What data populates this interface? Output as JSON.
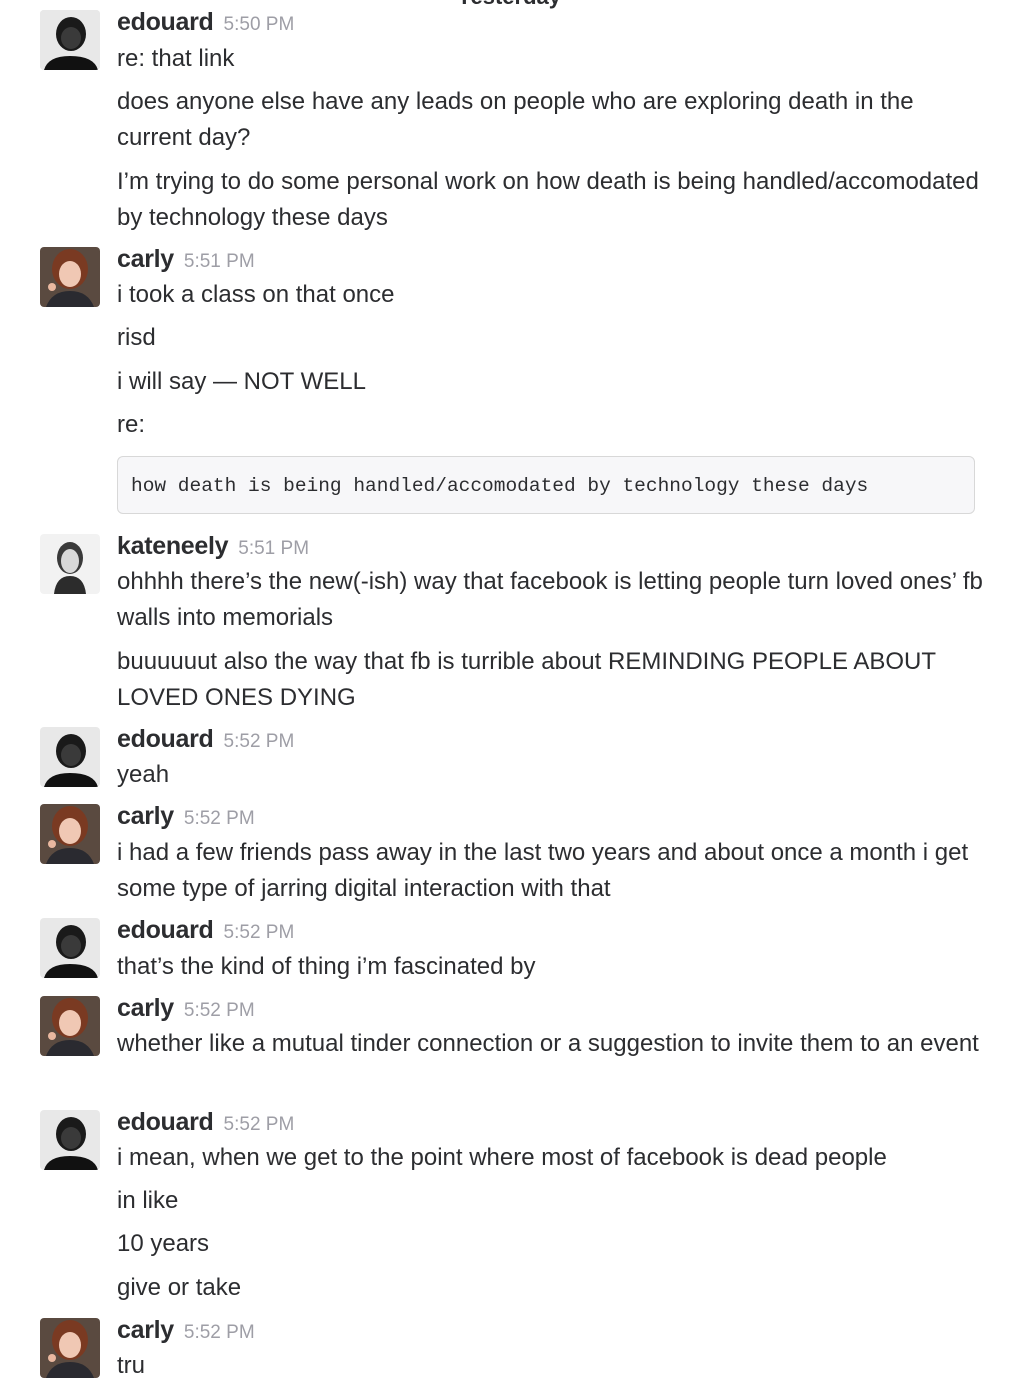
{
  "day_divider": "Yesterday",
  "messages": [
    {
      "user": "edouard",
      "time": "5:50 PM",
      "lines": [
        "re: that link",
        "does anyone else have any leads on people who are exploring death in the current day?",
        "I’m trying to do some personal work on how death is being handled/accomodated by technology these days"
      ]
    },
    {
      "user": "carly",
      "time": "5:51 PM",
      "lines": [
        "i took a class on that once",
        "risd",
        "i will say — NOT WELL",
        "re:"
      ],
      "code": "how death is being handled/accomodated by technology these days"
    },
    {
      "user": "kateneely",
      "time": "5:51 PM",
      "lines": [
        "ohhhh there’s the new(-ish) way that facebook is letting people turn loved ones’ fb walls into memorials",
        "buuuuuut also the way that fb is turrible about REMINDING PEOPLE ABOUT LOVED ONES DYING"
      ]
    },
    {
      "user": "edouard",
      "time": "5:52 PM",
      "lines": [
        "yeah"
      ]
    },
    {
      "user": "carly",
      "time": "5:52 PM",
      "lines": [
        "i had a few friends pass away in the last two years and about once a month i get some type of jarring digital interaction with that"
      ]
    },
    {
      "user": "edouard",
      "time": "5:52 PM",
      "lines": [
        "that’s the kind of thing i’m fascinated by"
      ]
    },
    {
      "user": "carly",
      "time": "5:52 PM",
      "lines": [
        "whether like a mutual tinder connection or a suggestion to invite them to an event"
      ]
    },
    {
      "user": "edouard",
      "time": "5:52 PM",
      "lines": [
        "i mean, when we get to the point where most of facebook is dead people",
        "in like",
        "10 years",
        "give or take"
      ]
    },
    {
      "user": "carly",
      "time": "5:52 PM",
      "lines": [
        "tru"
      ]
    }
  ]
}
